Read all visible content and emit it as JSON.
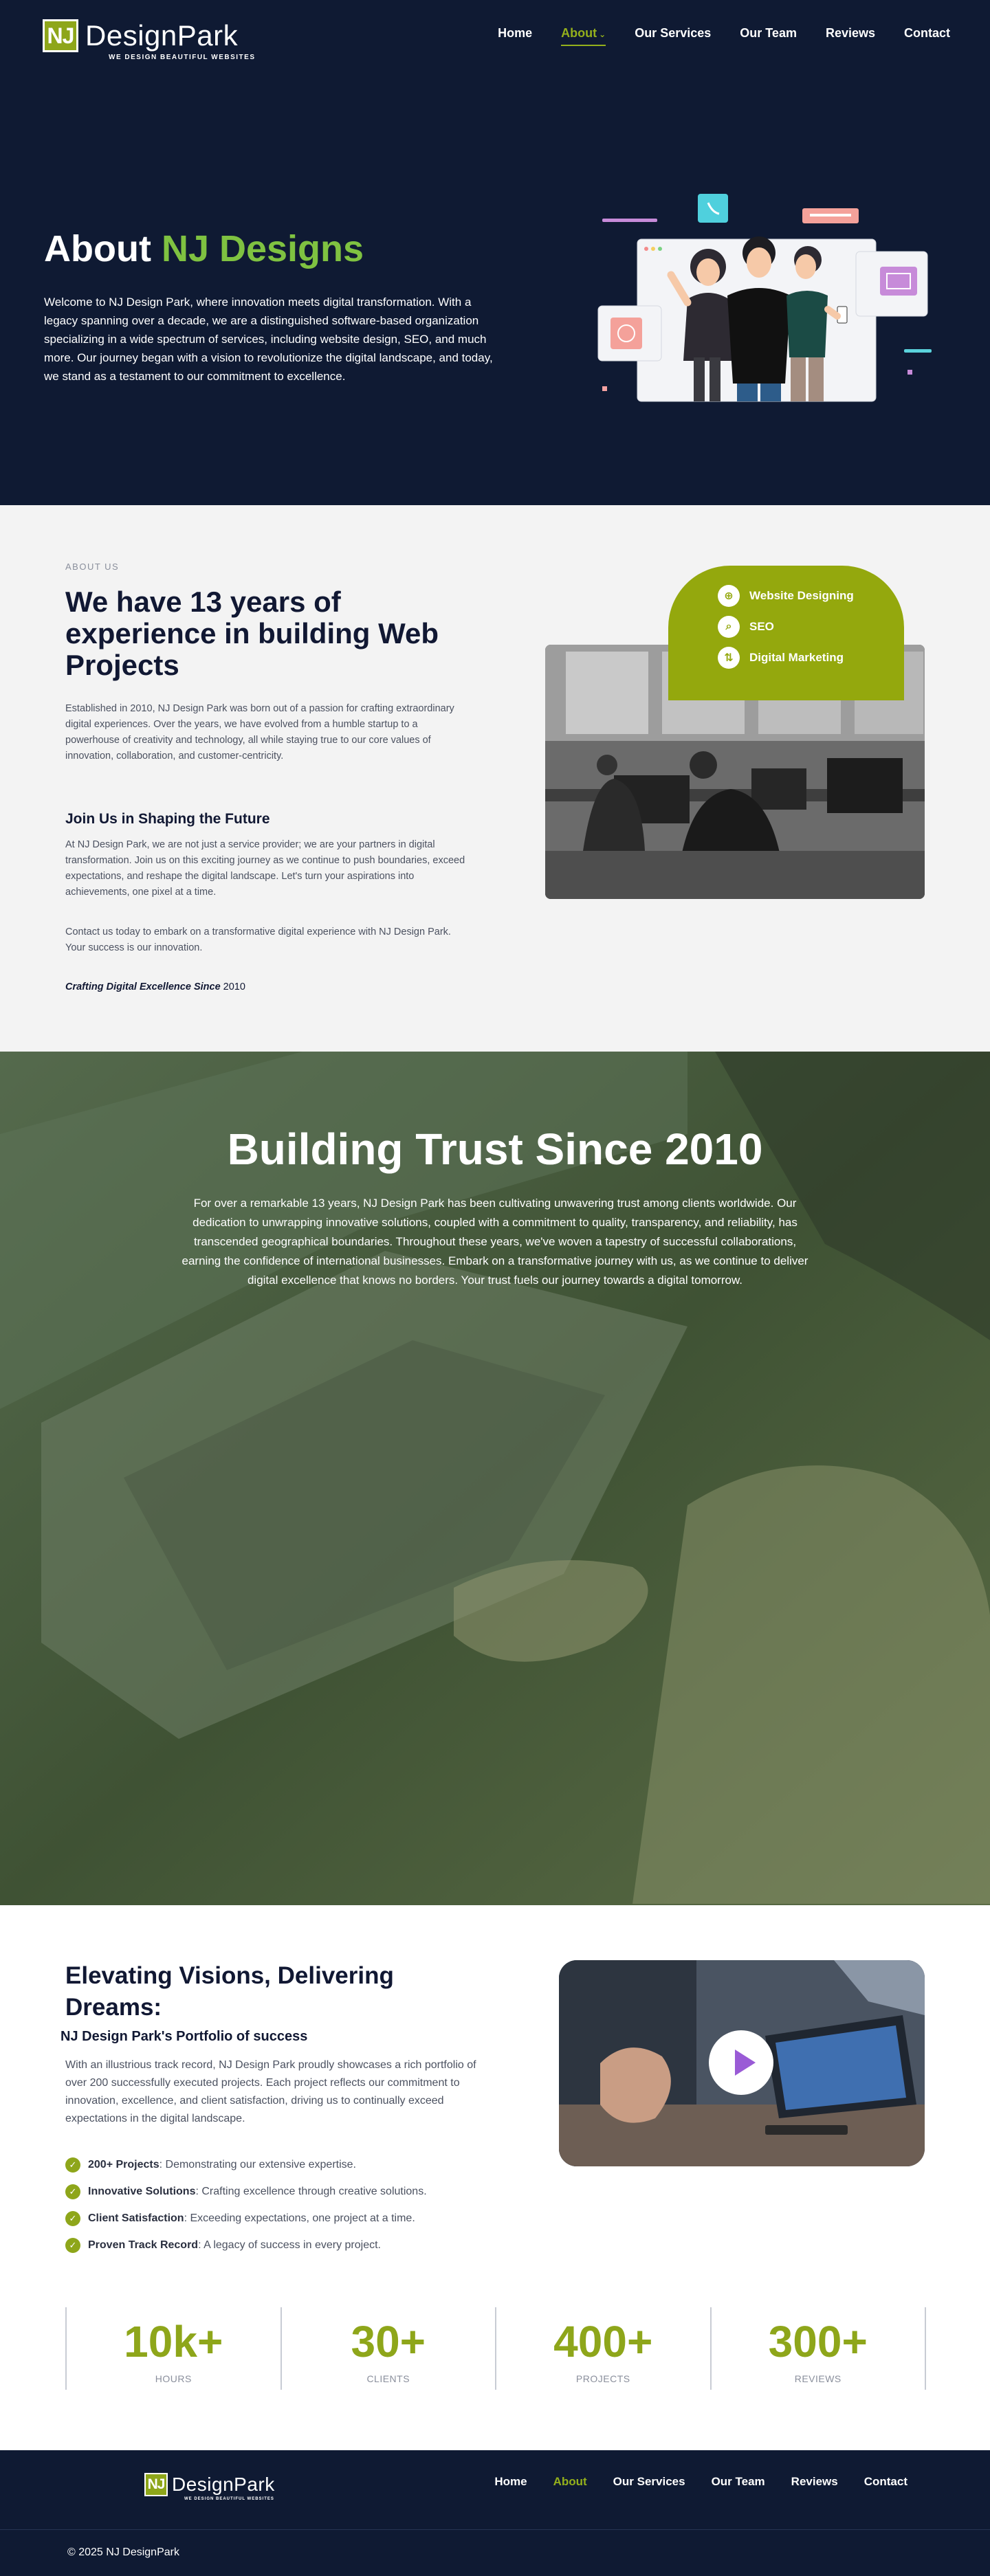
{
  "brand": {
    "initials": "NJ",
    "name": "DesignPark",
    "tagline": "WE DESIGN BEAUTIFUL WEBSITES",
    "primary_color": "#8ea61a",
    "dark_color": "#0f1a33"
  },
  "nav": {
    "items": [
      {
        "label": "Home",
        "active": false
      },
      {
        "label": "About",
        "active": true,
        "has_dropdown": true
      },
      {
        "label": "Our Services",
        "active": false
      },
      {
        "label": "Our Team",
        "active": false
      },
      {
        "label": "Reviews",
        "active": false
      },
      {
        "label": "Contact",
        "active": false
      }
    ]
  },
  "hero": {
    "title_prefix": "About",
    "title_accent": "NJ Designs",
    "text": "Welcome to NJ Design Park, where innovation meets digital transformation. With a legacy spanning over a decade, we are a distinguished software-based organization specializing in a wide spectrum of services, including website design, SEO, and much more. Our journey began with a vision to revolutionize the digital landscape, and today, we stand as a testament to our commitment to excellence."
  },
  "about": {
    "eyebrow": "ABOUT US",
    "heading": "We have 13 years of experience in building Web Projects",
    "p1": "Established in 2010, NJ Design Park was born out of a passion for crafting extraordinary digital experiences. Over the years, we have evolved from a humble startup to a powerhouse of creativity and technology, all while staying true to our core values of innovation, collaboration, and customer-centricity.",
    "join_heading": "Join Us in Shaping the Future",
    "p2": "At NJ Design Park, we are not just a service provider; we are your partners in digital transformation. Join us on this exciting journey as we continue to push boundaries, exceed expectations, and reshape the digital landscape. Let's turn your aspirations into achievements, one pixel at a time.",
    "p3": "Contact us today to embark on a transformative digital experience with NJ Design Park. Your success is our innovation.",
    "crafting_italic": "Crafting Digital Excellence Since",
    "crafting_year": "2010",
    "services": [
      {
        "icon": "globe-icon",
        "glyph": "⊕",
        "label": "Website Designing"
      },
      {
        "icon": "search-icon",
        "glyph": "⌕",
        "label": "SEO"
      },
      {
        "icon": "marketing-icon",
        "glyph": "⇅",
        "label": "Digital Marketing"
      }
    ]
  },
  "trust": {
    "heading": "Building Trust Since 2010",
    "text": "For over a remarkable 13 years, NJ Design Park has been cultivating unwavering trust among clients worldwide. Our dedication to unwrapping innovative solutions, coupled with a commitment to quality, transparency, and reliability, has transcended geographical boundaries. Throughout these years, we've woven a tapestry of successful collaborations, earning the confidence of international businesses. Embark on a transformative journey with us, as we continue to deliver digital excellence that knows no borders. Your trust fuels our journey towards a digital tomorrow."
  },
  "portfolio": {
    "heading": "Elevating Visions, Delivering Dreams:",
    "subheading": "NJ Design Park's Portfolio of success",
    "text": "With an illustrious track record, NJ Design Park proudly showcases a rich portfolio of over 200 successfully executed projects. Each project reflects our commitment to innovation, excellence, and client satisfaction, driving us to continually exceed expectations in the digital landscape.",
    "checks": [
      {
        "bold": "200+ Projects",
        "rest": ": Demonstrating our extensive expertise."
      },
      {
        "bold": "Innovative Solutions",
        "rest": ": Crafting excellence through creative solutions."
      },
      {
        "bold": "Client Satisfaction",
        "rest": ": Exceeding expectations, one project at a time."
      },
      {
        "bold": "Proven Track Record",
        "rest": ": A legacy of success in every project."
      }
    ]
  },
  "stats": [
    {
      "value": "10k+",
      "label": "HOURS"
    },
    {
      "value": "30+",
      "label": "CLIENTS"
    },
    {
      "value": "400+",
      "label": "PROJECTS"
    },
    {
      "value": "300+",
      "label": "REVIEWS"
    }
  ],
  "footer": {
    "nav": [
      {
        "label": "Home",
        "active": false
      },
      {
        "label": "About",
        "active": true
      },
      {
        "label": "Our Services",
        "active": false
      },
      {
        "label": "Our Team",
        "active": false
      },
      {
        "label": "Reviews",
        "active": false
      },
      {
        "label": "Contact",
        "active": false
      }
    ],
    "copyright": "© 2025 NJ DesignPark"
  }
}
